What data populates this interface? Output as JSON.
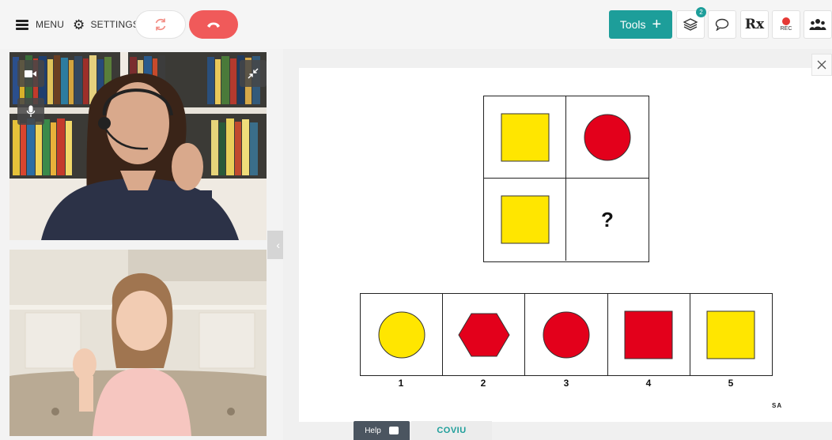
{
  "topbar": {
    "menu_label": "MENU",
    "settings_label": "SETTINGS",
    "tools_label": "Tools",
    "layers_badge": "2",
    "rx_label": "Rx",
    "rec_label": "REC",
    "icons": [
      "hamburger-icon",
      "gear-icon",
      "refresh-icon",
      "hangup-phone-icon",
      "plus-icon",
      "layers-icon",
      "chat-bubble-icon",
      "rx-icon",
      "record-icon",
      "group-icon"
    ]
  },
  "video": {
    "icons": [
      "video-camera-icon",
      "microphone-icon",
      "collapse-icon"
    ]
  },
  "divider": {
    "prev": "‹",
    "next": "›"
  },
  "whiteboard": {
    "matrix_missing": "?",
    "matrix": [
      {
        "shape": "square",
        "color": "#ffe600"
      },
      {
        "shape": "circle",
        "color": "#e3001b"
      },
      {
        "shape": "square",
        "color": "#ffe600"
      },
      {
        "shape": "missing"
      }
    ],
    "options": [
      {
        "number": "1",
        "shape": "circle",
        "color": "#ffe600"
      },
      {
        "number": "2",
        "shape": "hexagon",
        "color": "#e3001b"
      },
      {
        "number": "3",
        "shape": "circle",
        "color": "#e3001b"
      },
      {
        "number": "4",
        "shape": "square",
        "color": "#e3001b"
      },
      {
        "number": "5",
        "shape": "square",
        "color": "#ffe600"
      }
    ],
    "initials": "SA"
  },
  "footer": {
    "help_label": "Help",
    "brand": "COVIU"
  },
  "colors": {
    "accent": "#1d9e9a",
    "hangup": "#f05a5a",
    "record": "#e53935"
  }
}
